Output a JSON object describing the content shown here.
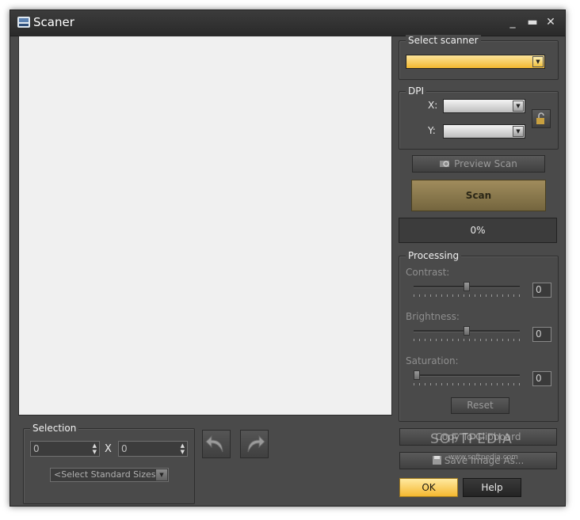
{
  "window": {
    "title": "Scaner"
  },
  "scanner": {
    "group_label": "Select scanner",
    "selected": ""
  },
  "dpi": {
    "group_label": "DPI",
    "x_label": "X:",
    "y_label": "Y:",
    "x_value": "",
    "y_value": ""
  },
  "actions": {
    "preview_scan": "Preview Scan",
    "scan": "Scan"
  },
  "progress": {
    "text": "0%",
    "value": 0
  },
  "processing": {
    "group_label": "Processing",
    "contrast": {
      "label": "Contrast:",
      "value": "0",
      "level": 0.5
    },
    "brightness": {
      "label": "Brightness:",
      "value": "0",
      "level": 0.5
    },
    "saturation": {
      "label": "Saturation:",
      "value": "0",
      "level": 0.0
    },
    "reset": "Reset"
  },
  "output": {
    "copy": "Copy To Clipboard",
    "save": "Save Image As..."
  },
  "dialog": {
    "ok": "OK",
    "help": "Help"
  },
  "selection": {
    "group_label": "Selection",
    "width": "0",
    "height": "0",
    "separator": "X",
    "standard_sizes": "<Select Standard Sizes>"
  },
  "watermark": {
    "brand": "SOFTPEDIA",
    "url": "www.softpedia.com"
  },
  "colors": {
    "scan_button": "#8a7a50",
    "ok_button": "#ffd35a",
    "scanner_combo": "#f8c84a"
  }
}
